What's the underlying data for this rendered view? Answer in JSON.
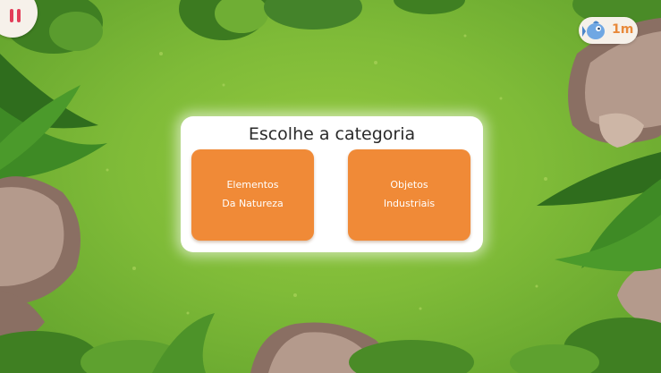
{
  "game": {
    "pause_icon": "pause-icon",
    "timer": {
      "icon": "mascot-fish-icon",
      "value": "1m"
    },
    "dialog": {
      "title": "Escolhe a categoria",
      "categories": [
        {
          "line1": "Elementos",
          "line2": "Da Natureza"
        },
        {
          "line1": "Objetos",
          "line2": "Industriais"
        }
      ]
    }
  },
  "colors": {
    "grass": "#7fbb38",
    "button": "#f08a37",
    "pause_accent": "#e33d59",
    "timer_text": "#e8893a",
    "dialog_bg": "#ffffff"
  }
}
